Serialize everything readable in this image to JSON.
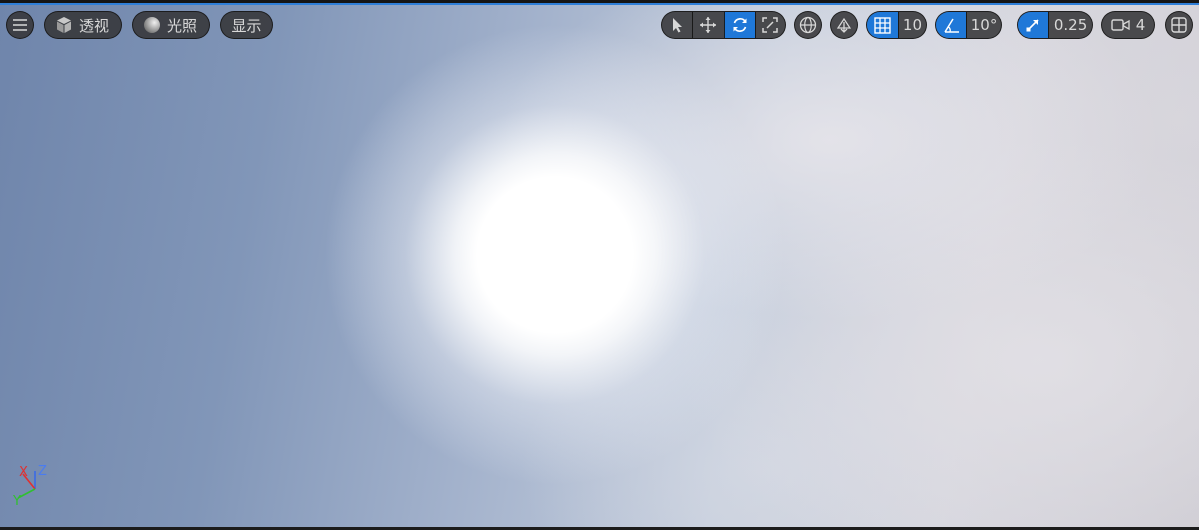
{
  "toolbar_left": {
    "menu_icon": "hamburger-menu-icon",
    "view_mode": {
      "label": "透视",
      "icon": "cube-icon"
    },
    "lighting": {
      "label": "光照",
      "icon": "sphere-icon"
    },
    "show": {
      "label": "显示"
    }
  },
  "toolbar_right": {
    "transform_tools": [
      "select-arrow-icon",
      "move-icon",
      "rotate-icon",
      "scale-icon"
    ],
    "active_tool": "rotate",
    "coordinate_space_icon": "globe-icon",
    "surface_snap_icon": "surface-snap-icon",
    "grid_snap": {
      "value": "10",
      "icon": "grid-icon",
      "enabled": true
    },
    "rotation_snap": {
      "value": "10°",
      "icon": "angle-icon",
      "enabled": true
    },
    "scale_snap": {
      "value": "0.25",
      "icon": "scale-snap-icon",
      "enabled": true
    },
    "camera_speed": {
      "value": "4",
      "icon": "camera-icon"
    },
    "layout_icon": "viewport-layout-icon"
  },
  "axis_indicator": {
    "x": "X",
    "y": "Y",
    "z": "Z"
  },
  "colors": {
    "accent": "#1f78d8",
    "toolbar_bg": "#363638",
    "axis_x": "#e03030",
    "axis_y": "#30c030",
    "axis_z": "#3a6be8"
  }
}
